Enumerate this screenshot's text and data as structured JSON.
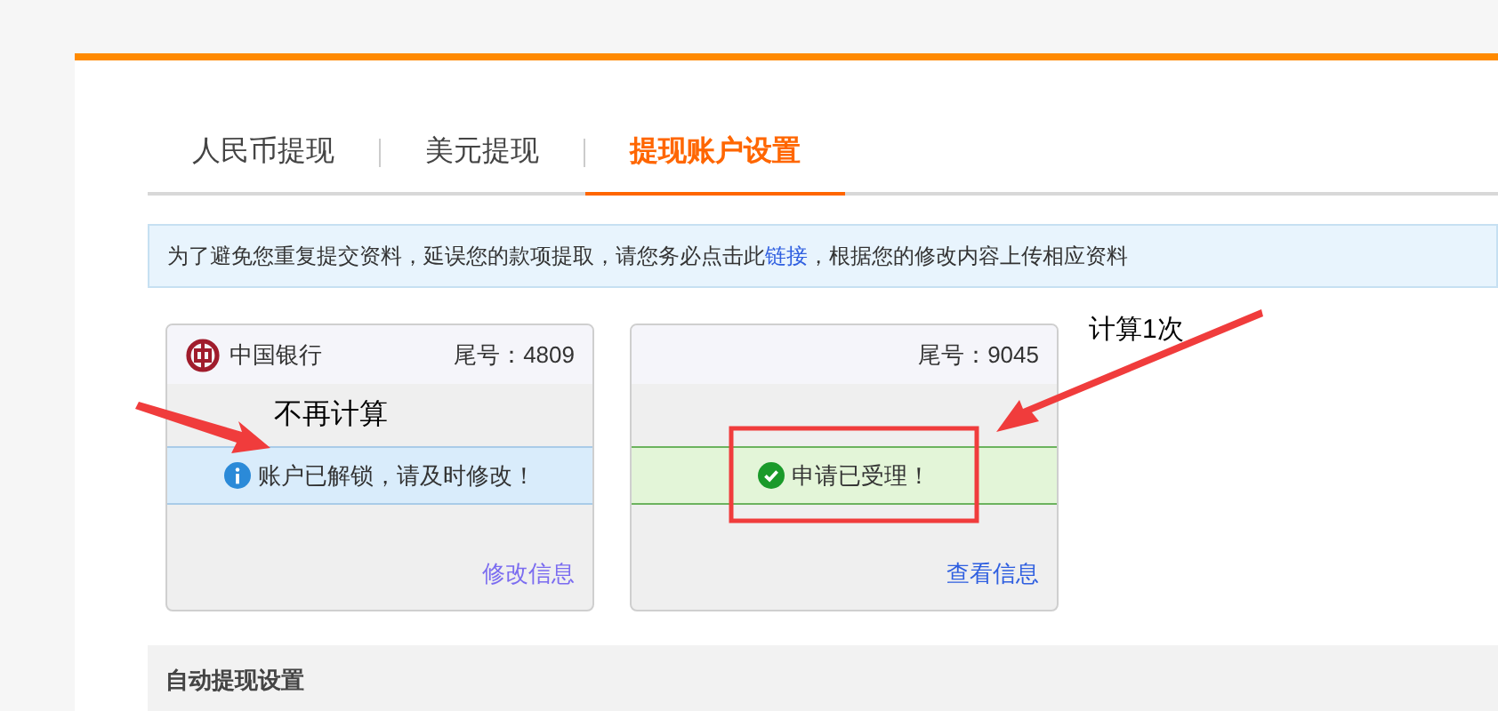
{
  "tabs": [
    {
      "label": "人民币提现",
      "selected": false
    },
    {
      "label": "美元提现",
      "selected": false
    },
    {
      "label": "提现账户设置",
      "selected": true
    }
  ],
  "notice": {
    "text": "为了避免您重复提交资料，延误您的款项提取，请您务必点击此",
    "link": "链接",
    "text_after": "，根据您的修改内容上传相应资料"
  },
  "cards": [
    {
      "bank": "中国银行",
      "tail": "尾号：4809",
      "status": {
        "kind": "info",
        "text": "账户已解锁，请及时修改！"
      },
      "action": "修改信息"
    },
    {
      "tail": "尾号：9045",
      "status": {
        "kind": "success",
        "text": "申请已受理！"
      },
      "action": "查看信息"
    }
  ],
  "section": {
    "title": "自动提现设置"
  },
  "annotations": [
    {
      "text": "不再计算"
    },
    {
      "text": "计算1次"
    }
  ]
}
